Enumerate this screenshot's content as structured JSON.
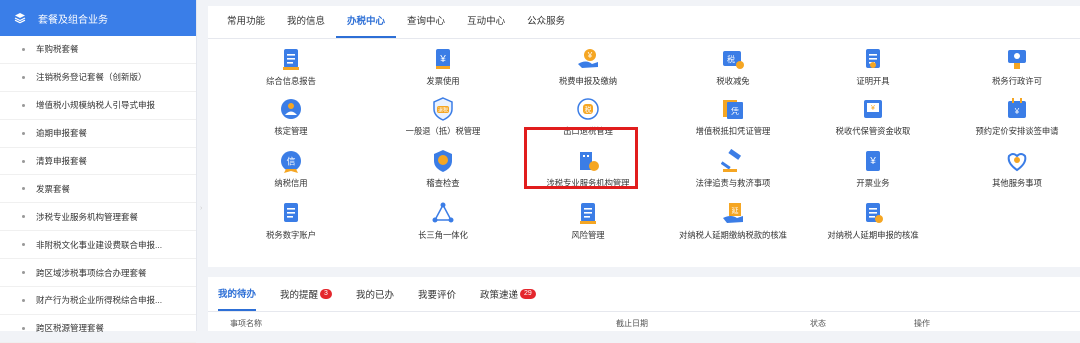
{
  "sidebar": {
    "header": "套餐及组合业务",
    "items": [
      "车购税套餐",
      "注销税务登记套餐（创新版）",
      "增值税小规模纳税人引导式申报",
      "逾期申报套餐",
      "清算申报套餐",
      "发票套餐",
      "涉税专业服务机构管理套餐",
      "非附税文化事业建设费联合申报...",
      "跨区域涉税事项综合办理套餐",
      "财产行为税企业所得税综合申报...",
      "跨区税源管理套餐"
    ]
  },
  "tabs": [
    "常用功能",
    "我的信息",
    "办税中心",
    "查询中心",
    "互动中心",
    "公众服务"
  ],
  "active_tab": "办税中心",
  "services": [
    {
      "label": "综合信息报告",
      "icon": "report-icon"
    },
    {
      "label": "发票使用",
      "icon": "invoice-icon"
    },
    {
      "label": "税费申报及缴纳",
      "icon": "tax-payment-icon"
    },
    {
      "label": "税收减免",
      "icon": "tax-relief-icon"
    },
    {
      "label": "证明开具",
      "icon": "certificate-icon"
    },
    {
      "label": "税务行政许可",
      "icon": "admin-permit-icon"
    },
    {
      "label": "核定管理",
      "icon": "assessment-icon"
    },
    {
      "label": "一般退（抵）税管理",
      "icon": "refund-icon"
    },
    {
      "label": "出口退税管理",
      "icon": "export-refund-icon"
    },
    {
      "label": "增值税抵扣凭证管理",
      "icon": "vat-deduction-icon"
    },
    {
      "label": "税收代保管资金收取",
      "icon": "custody-fund-icon"
    },
    {
      "label": "预约定价安排谈签申请",
      "icon": "pricing-arrangement-icon"
    },
    {
      "label": "纳税信用",
      "icon": "tax-credit-icon"
    },
    {
      "label": "稽查检查",
      "icon": "inspection-icon"
    },
    {
      "label": "涉税专业服务机构管理",
      "icon": "agency-icon"
    },
    {
      "label": "法律追责与救济事项",
      "icon": "legal-icon"
    },
    {
      "label": "开票业务",
      "icon": "billing-icon"
    },
    {
      "label": "其他服务事项",
      "icon": "other-services-icon"
    },
    {
      "label": "税务数字账户",
      "icon": "digital-account-icon"
    },
    {
      "label": "长三角一体化",
      "icon": "yangtze-delta-icon"
    },
    {
      "label": "风险管理",
      "icon": "risk-icon"
    },
    {
      "label": "对纳税人延期缴纳税款的核准",
      "icon": "deferred-payment-icon"
    },
    {
      "label": "对纳税人延期申报的核准",
      "icon": "deferred-filing-icon"
    }
  ],
  "bottom_tabs": [
    {
      "label": "我的待办",
      "badge": ""
    },
    {
      "label": "我的提醒",
      "badge": "3"
    },
    {
      "label": "我的已办",
      "badge": ""
    },
    {
      "label": "我要评价",
      "badge": ""
    },
    {
      "label": "政策速递",
      "badge": "29"
    }
  ],
  "table_headers": [
    "事项名称",
    "截止日期",
    "状态",
    "操作"
  ],
  "colors": {
    "primary": "#2d6fd6",
    "highlight": "#e11d1d",
    "icon_blue": "#3b7de6",
    "icon_orange": "#f5a623",
    "badge": "#e4272d"
  }
}
